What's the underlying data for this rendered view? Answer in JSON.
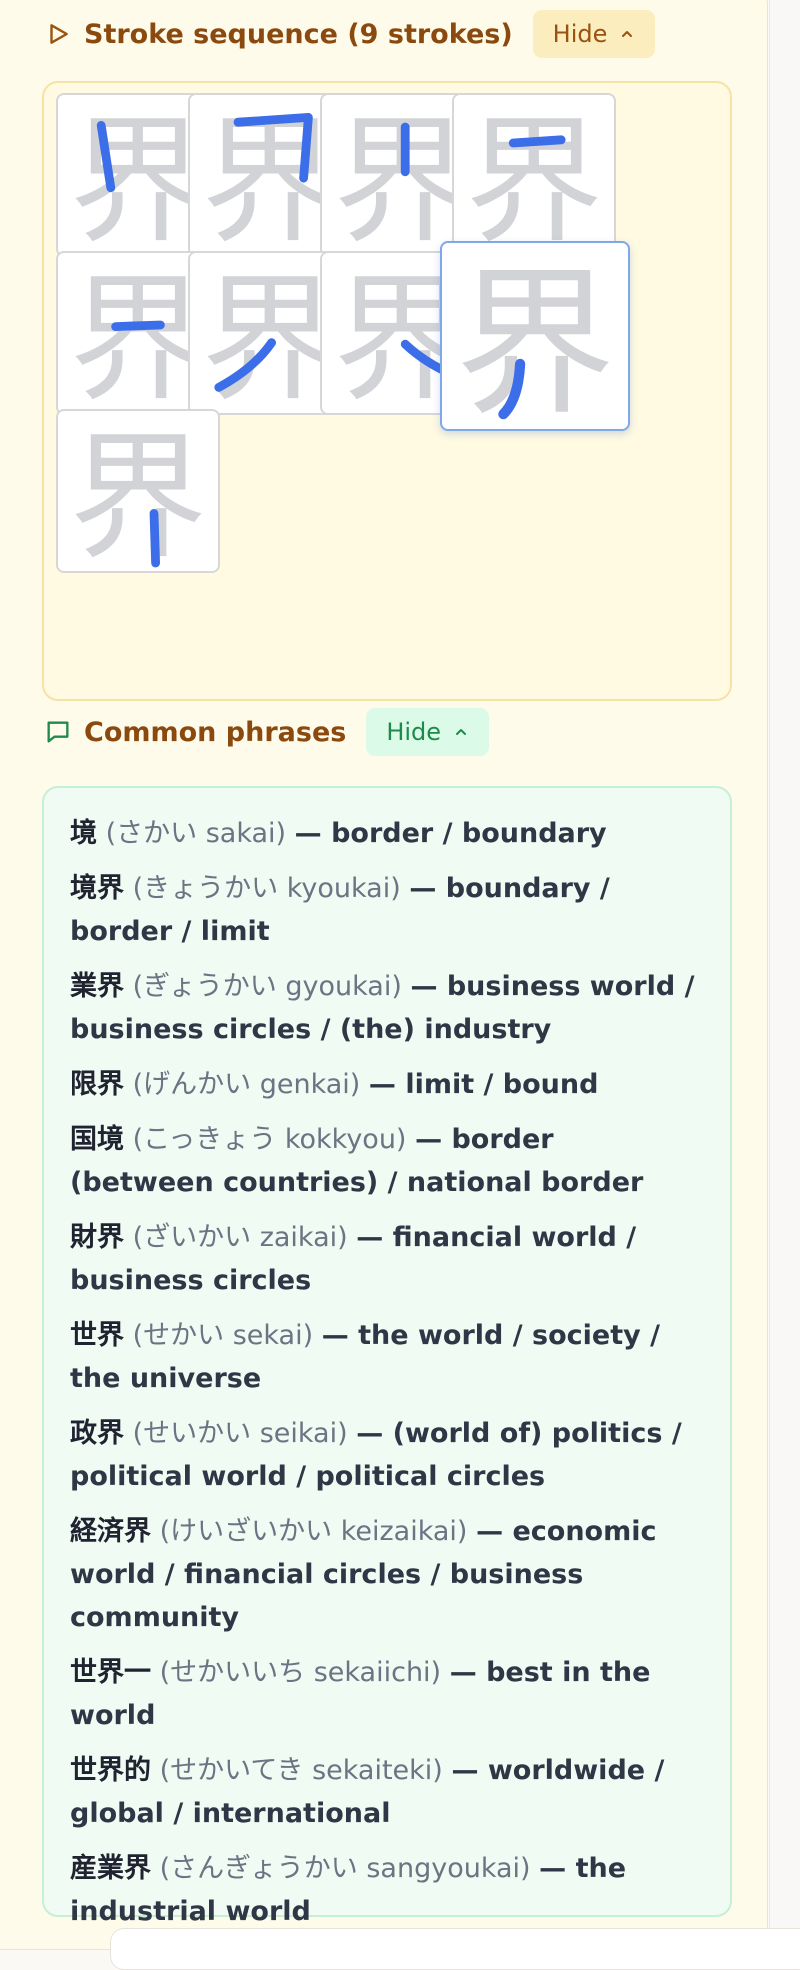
{
  "strokes": {
    "title": "Stroke sequence (9 strokes)",
    "toggle_label": "Hide",
    "character": "界",
    "count": 9,
    "active_index": 8,
    "stroke_color": "#3b6ee8"
  },
  "phrases": {
    "title": "Common phrases",
    "toggle_label": "Hide",
    "items": [
      {
        "word": "境",
        "reading": "(さかい sakai)",
        "meaning": "— border / boundary"
      },
      {
        "word": "境界",
        "reading": "(きょうかい kyoukai)",
        "meaning": "— boundary / border / limit"
      },
      {
        "word": "業界",
        "reading": "(ぎょうかい gyoukai)",
        "meaning": "— business world / business circles / (the) industry"
      },
      {
        "word": "限界",
        "reading": "(げんかい genkai)",
        "meaning": "— limit / bound"
      },
      {
        "word": "国境",
        "reading": "(こっきょう kokkyou)",
        "meaning": "— border (between countries) / national border"
      },
      {
        "word": "財界",
        "reading": "(ざいかい zaikai)",
        "meaning": "— financial world / business circles"
      },
      {
        "word": "世界",
        "reading": "(せかい sekai)",
        "meaning": "— the world / society / the universe"
      },
      {
        "word": "政界",
        "reading": "(せいかい seikai)",
        "meaning": "— (world of) politics / political world / political circles"
      },
      {
        "word": "経済界",
        "reading": "(けいざいかい keizaikai)",
        "meaning": "— economic world / financial circles / business community"
      },
      {
        "word": "世界一",
        "reading": "(せかいいち sekaiichi)",
        "meaning": "— best in the world"
      },
      {
        "word": "世界的",
        "reading": "(せかいてき sekaiteki)",
        "meaning": "— worldwide / global / international"
      },
      {
        "word": "産業界",
        "reading": "(さんぎょうかい sangyoukai)",
        "meaning": "— the industrial world"
      }
    ]
  }
}
